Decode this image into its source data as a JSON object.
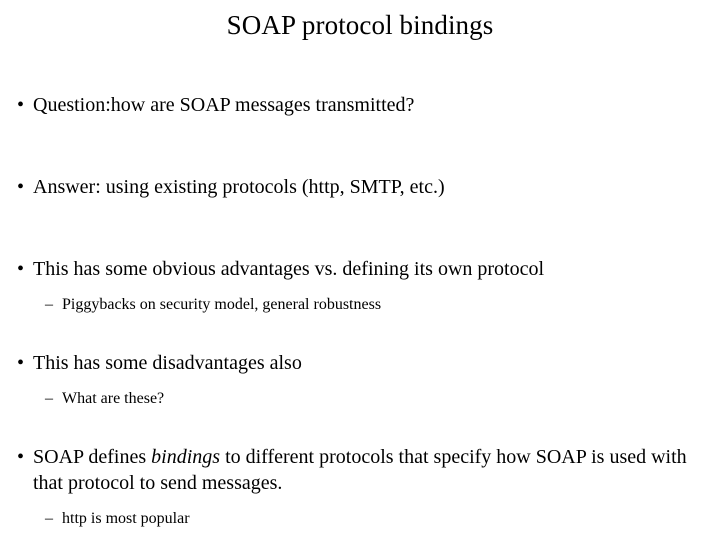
{
  "slide": {
    "title": "SOAP protocol bindings",
    "bullet_marker_level1": "•",
    "bullet_marker_level2": "–",
    "text_color": "#000000",
    "background_color": "#ffffff",
    "items": [
      {
        "level": 1,
        "text": "Question:how are SOAP messages transmitted?"
      },
      {
        "level": 1,
        "text": "Answer: using existing protocols (http, SMTP, etc.)"
      },
      {
        "level": 1,
        "text": "This has some obvious advantages vs. defining its own protocol"
      },
      {
        "level": 2,
        "text": "Piggybacks on security model, general robustness"
      },
      {
        "level": 1,
        "text": "This has some disadvantages also"
      },
      {
        "level": 2,
        "text": "What are these?"
      },
      {
        "level": 1,
        "text_before_italic": "SOAP defines ",
        "italic_text": "bindings",
        "text_after_italic": " to different protocols that specify how SOAP is used with that protocol to send messages."
      },
      {
        "level": 2,
        "text": "http is most popular"
      }
    ]
  }
}
